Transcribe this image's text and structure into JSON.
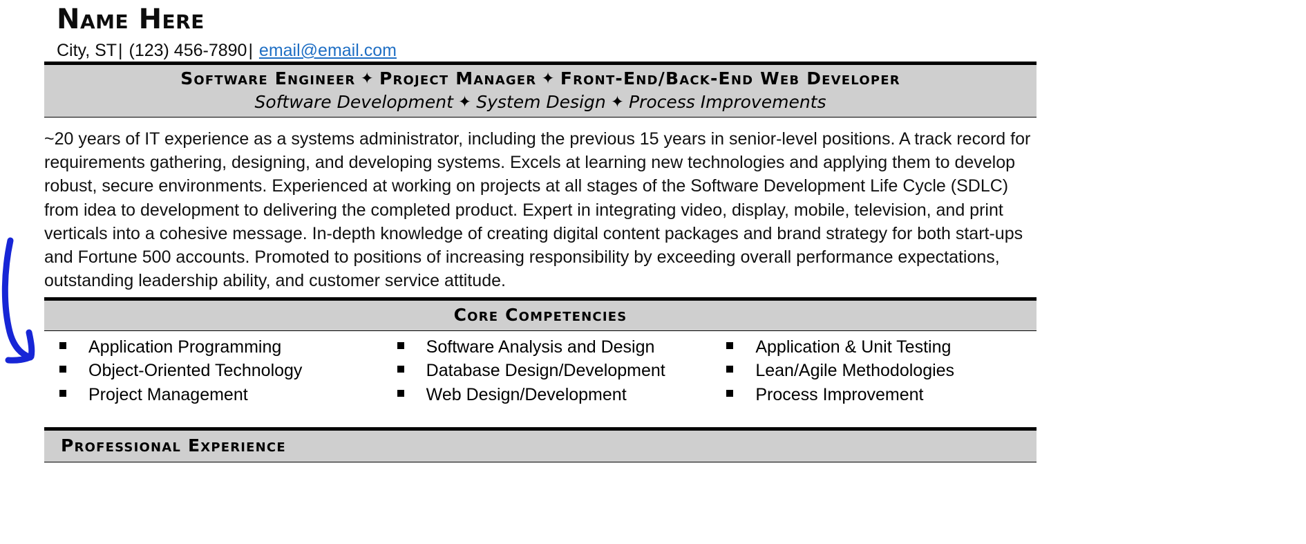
{
  "document": {
    "type": "resume",
    "accent_link_color": "#1f6fc4",
    "band_background": "#cfcfcf",
    "annotation_color": "#1726d6"
  },
  "header": {
    "name": "Name Here",
    "location": "City, ST",
    "separator_1": "|",
    "phone": "(123) 456-7890",
    "separator_2": "|",
    "email": "email@email.com"
  },
  "title_band": {
    "star": "✦",
    "roles": [
      "Software Engineer",
      "Project Manager",
      "Front-End/Back-End Web Developer"
    ],
    "specialties": [
      "Software Development",
      "System Design",
      "Process Improvements"
    ]
  },
  "summary": {
    "text": "~20 years of IT experience as a systems administrator, including the previous 15 years in senior-level positions. A track record for requirements gathering, designing, and developing systems. Excels at learning new technologies and applying them to develop robust, secure environments. Experienced at working on projects at all stages of the Software Development Life Cycle (SDLC) from idea to development to delivering the completed product. Expert in integrating video, display, mobile, television, and print verticals into a cohesive message. In-depth knowledge of creating digital content packages and brand strategy for both start-ups and Fortune 500 accounts. Promoted to positions of increasing responsibility by exceeding overall performance expectations, outstanding leadership ability, and customer service attitude."
  },
  "core_competencies": {
    "heading": "Core Competencies",
    "columns": [
      [
        "Application Programming",
        "Object-Oriented Technology",
        "Project Management"
      ],
      [
        "Software Analysis and Design",
        "Database Design/Development",
        "Web Design/Development"
      ],
      [
        "Application & Unit Testing",
        "Lean/Agile Methodologies",
        "Process Improvement"
      ]
    ]
  },
  "professional_experience": {
    "heading": "Professional Experience"
  },
  "annotation": {
    "name": "blue-curved-arrow",
    "description": "hand-drawn blue arrow pointing down-right toward the Core Competencies band"
  }
}
